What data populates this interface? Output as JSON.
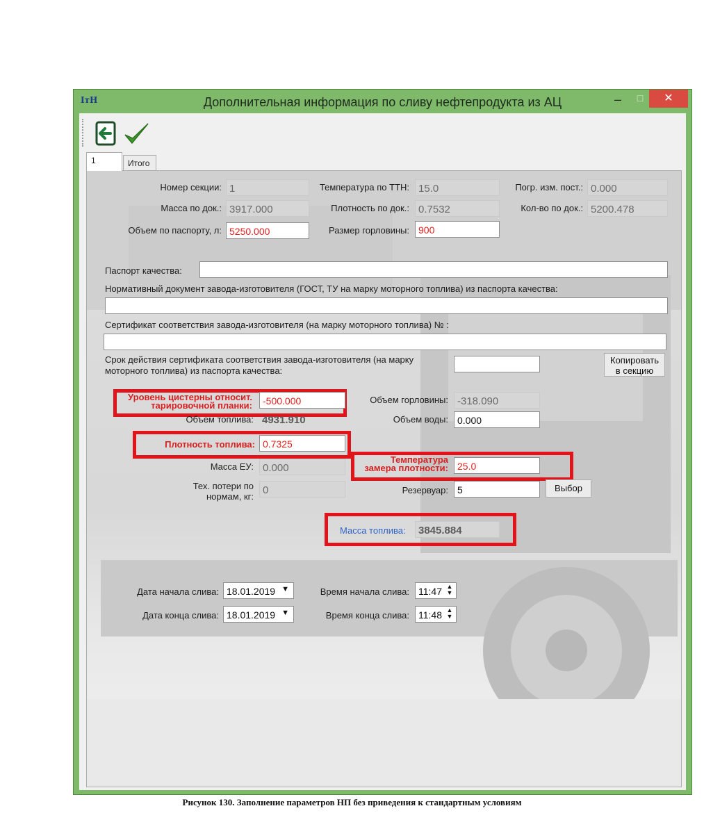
{
  "window": {
    "app_icon_text": "IтH",
    "title": "Дополнительная информация по сливу нефтепродукта из АЦ",
    "min": "–",
    "max": "□",
    "close": "✕"
  },
  "tabs": [
    "1",
    "Итого"
  ],
  "fields": {
    "section_no_label": "Номер секции:",
    "section_no": "1",
    "temp_ttn_label": "Температура по ТТН:",
    "temp_ttn": "15.0",
    "error_label": "Погр. изм. пост.:",
    "error": "0.000",
    "mass_doc_label": "Масса по док.:",
    "mass_doc": "3917.000",
    "density_doc_label": "Плотность по док.:",
    "density_doc": "0.7532",
    "qty_doc_label": "Кол-во по док.:",
    "qty_doc": "5200.478",
    "passport_vol_label": "Объем по паспорту, л:",
    "passport_vol": "5250.000",
    "neck_size_label": "Размер горловины:",
    "neck_size": "900",
    "quality_passport_label": "Паспорт качества:",
    "quality_passport": "",
    "normative_doc_label": "Нормативный документ завода-изготовителя (ГОСТ, ТУ на марку моторного топлива) из паспорта качества:",
    "normative_doc": "",
    "certificate_label": "Сертификат соответствия завода-изготовителя (на марку моторного топлива) № :",
    "certificate": "",
    "cert_validity_label_1": "Срок действия сертификата соответствия завода-изготовителя (на марку",
    "cert_validity_label_2": "моторного топлива) из паспорта качества:",
    "cert_validity": "",
    "copy_button_1": "Копировать",
    "copy_button_2": "в секцию",
    "level_label_1": "Уровень цистерны относит.",
    "level_label_2": "тарировочной планки:",
    "level": "-500.000",
    "neck_vol_label": "Объем горловины:",
    "neck_vol": "-318.090",
    "fuel_vol_label": "Объем топлива:",
    "fuel_vol": "4931.910",
    "water_vol_label": "Объем воды:",
    "water_vol": "0.000",
    "fuel_density_label": "Плотность топлива:",
    "fuel_density": "0.7325",
    "mass_eu_label": "Масса ЕУ:",
    "mass_eu": "0.000",
    "density_temp_label_1": "Температура",
    "density_temp_label_2": "замера плотности:",
    "density_temp": "25.0",
    "tech_loss_label_1": "Тех. потери по",
    "tech_loss_label_2": "нормам, кг:",
    "tech_loss": "0",
    "reservoir_label": "Резервуар:",
    "reservoir": "5",
    "select_button": "Выбор",
    "fuel_mass_label": "Масса топлива:",
    "fuel_mass": "3845.884",
    "start_date_label": "Дата начала слива:",
    "start_date": "18.01.2019",
    "start_time_label": "Время начала слива:",
    "start_time": "11:47",
    "end_date_label": "Дата конца слива:",
    "end_date": "18.01.2019",
    "end_time_label": "Время конца слива:",
    "end_time": "11:48"
  },
  "caption": "Рисунок 130. Заполнение параметров НП без приведения к стандартным условиям",
  "colors": {
    "title_bar": "#7fb96a",
    "highlight": "#e0141b",
    "close": "#d94b41"
  }
}
